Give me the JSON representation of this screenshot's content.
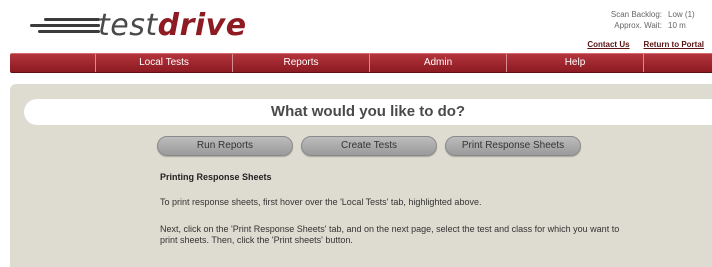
{
  "header": {
    "logo": {
      "part1": "test",
      "part2": "drive"
    },
    "status": [
      {
        "label": "Scan Backlog:",
        "value": "Low (1)"
      },
      {
        "label": "Approx. Wait:",
        "value": "10 m"
      }
    ],
    "links": {
      "contact": "Contact Us",
      "portal": "Return to Portal"
    }
  },
  "nav": {
    "items": [
      "Local Tests",
      "Reports",
      "Admin",
      "Help"
    ]
  },
  "main": {
    "question": "What would you like to do?",
    "buttons": {
      "run": "Run Reports",
      "create": "Create Tests",
      "print": "Print Response Sheets"
    },
    "section_title": "Printing Response Sheets",
    "para1": "To print response sheets, first hover over the 'Local Tests' tab, highlighted above.",
    "para2": "Next, click on the 'Print Response Sheets' tab, and on the next page, select the test and class for which you want to print sheets. Then, click the 'Print sheets' button."
  },
  "colors": {
    "nav": "#9e2229",
    "content_bg": "#dedcd0",
    "logo_accent": "#8e1b22"
  }
}
